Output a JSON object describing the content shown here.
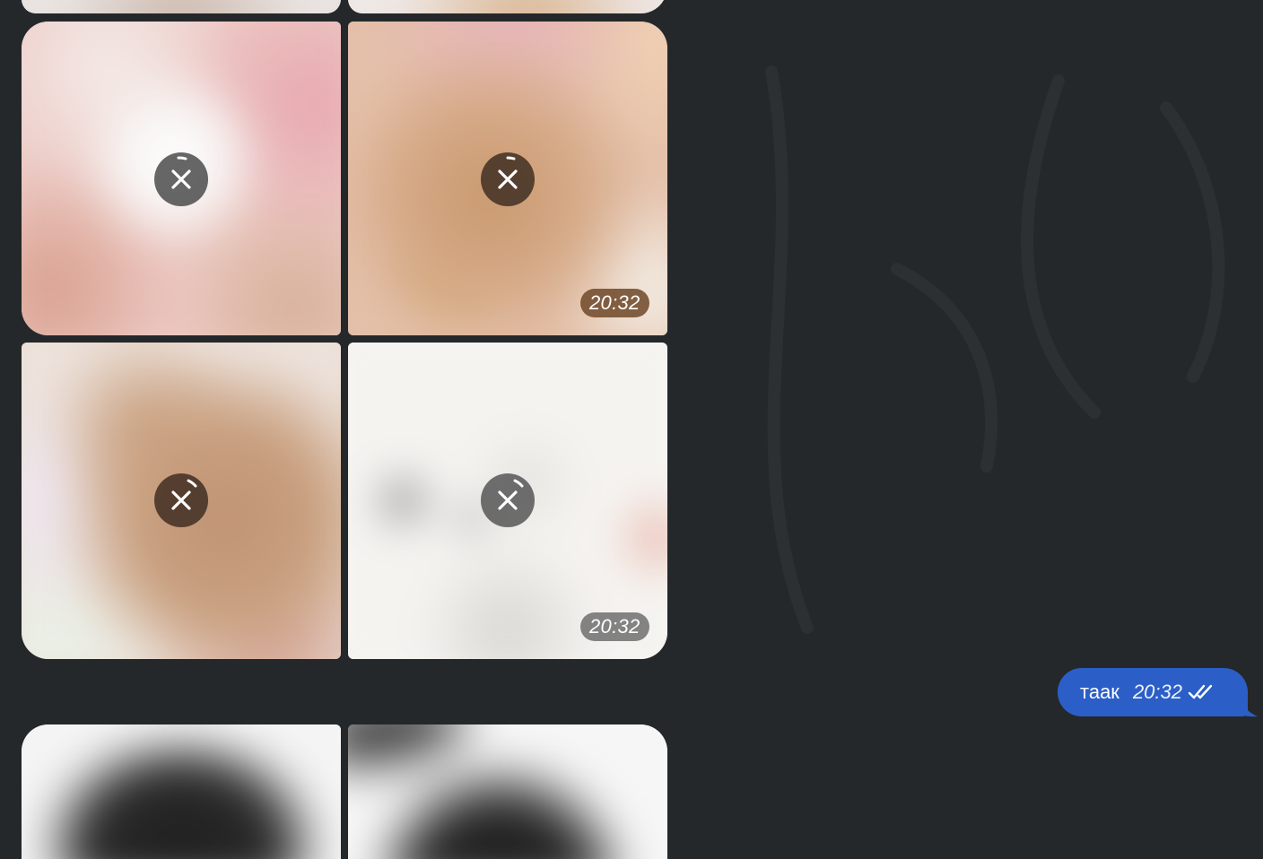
{
  "chat": {
    "photo_grid": {
      "tiles": [
        {
          "status": "loading",
          "time": ""
        },
        {
          "status": "loading",
          "time": "20:32"
        },
        {
          "status": "loading",
          "time": ""
        },
        {
          "status": "loading",
          "time": "20:32"
        }
      ]
    },
    "outgoing_message": {
      "text": "таак",
      "time": "20:32",
      "status_icon": "double-check-icon"
    },
    "icons": {
      "cancel": "close-icon"
    },
    "colors": {
      "background": "#25282a",
      "bubble": "#2b5fc7"
    }
  }
}
